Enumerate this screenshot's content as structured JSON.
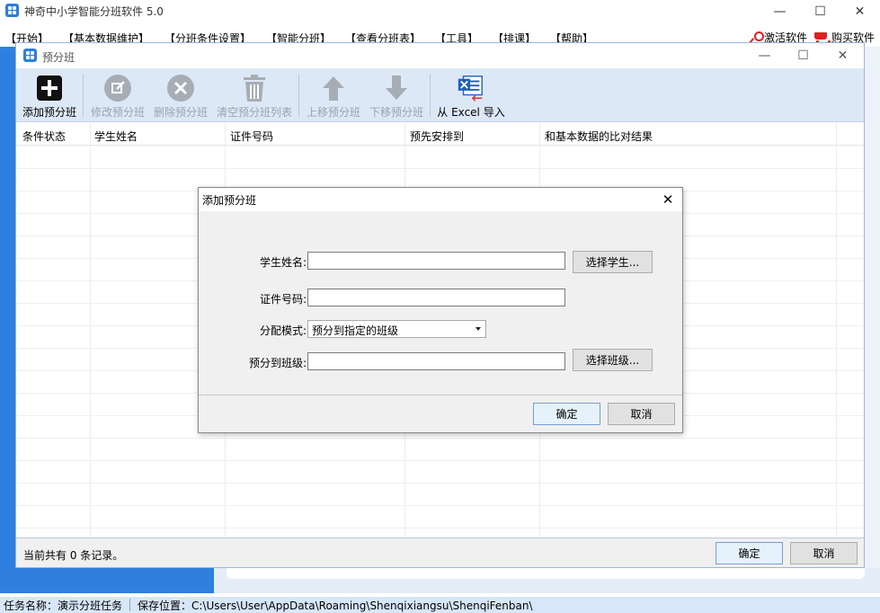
{
  "app": {
    "title": "神奇中小学智能分班软件 5.0",
    "min": "—",
    "max": "☐",
    "close": "✕"
  },
  "menu": [
    "【开始】",
    "【基本数据维护】",
    "【分班条件设置】",
    "【智能分班】",
    "【查看分班表】",
    "【工具】",
    "【排课】",
    "【帮助】"
  ],
  "links": {
    "activate": "激活软件",
    "buy": "购买软件"
  },
  "child_window": {
    "title": "预分班",
    "min": "—",
    "max": "☐",
    "close": "✕",
    "toolbar": [
      {
        "label": "添加预分班",
        "icon": "plus-icon",
        "enabled": true
      },
      {
        "label": "修改预分班",
        "icon": "edit-icon",
        "enabled": false
      },
      {
        "label": "删除预分班",
        "icon": "delete-icon",
        "enabled": false
      },
      {
        "label": "清空预分班列表",
        "icon": "trash-icon",
        "enabled": false
      },
      {
        "label": "上移预分班",
        "icon": "arrow-up-icon",
        "enabled": false
      },
      {
        "label": "下移预分班",
        "icon": "arrow-down-icon",
        "enabled": false
      },
      {
        "label": "从 Excel 导入",
        "icon": "excel-import-icon",
        "enabled": true
      }
    ],
    "table": {
      "columns": [
        "条件状态",
        "学生姓名",
        "证件号码",
        "预先安排到",
        "和基本数据的比对结果"
      ],
      "rows": []
    },
    "footer": {
      "record_count": "当前共有 0 条记录。",
      "ok": "确定",
      "cancel": "取消"
    }
  },
  "dialog": {
    "title": "添加预分班",
    "close": "✕",
    "fields": {
      "student_name": {
        "label": "学生姓名:",
        "value": ""
      },
      "id_number": {
        "label": "证件号码:",
        "value": ""
      },
      "mode": {
        "label": "分配模式:",
        "value": "预分到指定的班级"
      },
      "target_class": {
        "label": "预分到班级:",
        "value": ""
      }
    },
    "buttons": {
      "choose_student": "选择学生...",
      "choose_class": "选择班级...",
      "ok": "确定",
      "cancel": "取消"
    }
  },
  "statusbar": {
    "task": "任务名称：演示分班任务",
    "save_path": "保存位置：C:\\Users\\User\\AppData\\Roaming\\Shenqixiangsu\\ShenqiFenban\\"
  },
  "colors": {
    "accent_blue": "#2f7fe0",
    "toolbar_bg": "#dde8f6",
    "status_bg": "#d7e6f8",
    "danger_red": "#e02020"
  }
}
